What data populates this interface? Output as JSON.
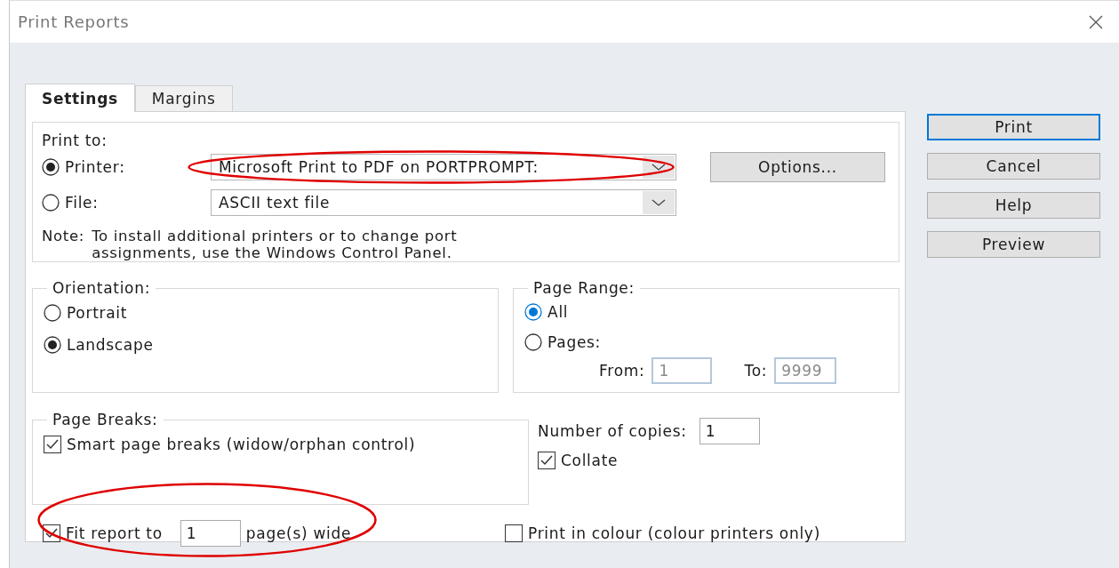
{
  "window": {
    "title": "Print Reports"
  },
  "tabs": [
    {
      "label": "Settings",
      "selected": true
    },
    {
      "label": "Margins",
      "selected": false
    }
  ],
  "print_to": {
    "label": "Print to:",
    "options": [
      {
        "label": "Printer:",
        "selected": true,
        "value": "Microsoft Print to PDF on PORTPROMPT:",
        "circled": true
      },
      {
        "label": "File:",
        "selected": false,
        "value": "ASCII text file",
        "circled": false
      }
    ],
    "options_button": "Options...",
    "note_label": "Note:",
    "note": "To install additional printers or to change port assignments, use the Windows Control Panel."
  },
  "orientation": {
    "label": "Orientation:",
    "options": [
      {
        "label": "Portrait",
        "selected": false
      },
      {
        "label": "Landscape",
        "selected": true
      }
    ]
  },
  "page_range": {
    "label": "Page Range:",
    "options": [
      {
        "label": "All",
        "selected": true,
        "focused": true
      },
      {
        "label": "Pages:",
        "selected": false,
        "focused": false
      }
    ],
    "from_label": "From:",
    "from": "1",
    "to_label": "To:",
    "to": "9999",
    "disabled": true
  },
  "page_breaks": {
    "label": "Page Breaks:",
    "smart": {
      "label": "Smart page breaks (widow/orphan control)",
      "checked": true
    }
  },
  "copies": {
    "label": "Number of copies:",
    "value": "1",
    "collate": {
      "label": "Collate",
      "checked": true
    }
  },
  "fit": {
    "checked": true,
    "label": "Fit report to",
    "value": "1",
    "suffix": "page(s) wide",
    "circled": true
  },
  "colour": {
    "label": "Print in colour (colour printers only)",
    "checked": false
  },
  "buttons": [
    {
      "label": "Print",
      "default": true
    },
    {
      "label": "Cancel",
      "default": false
    },
    {
      "label": "Help",
      "default": false
    },
    {
      "label": "Preview",
      "default": false
    }
  ]
}
